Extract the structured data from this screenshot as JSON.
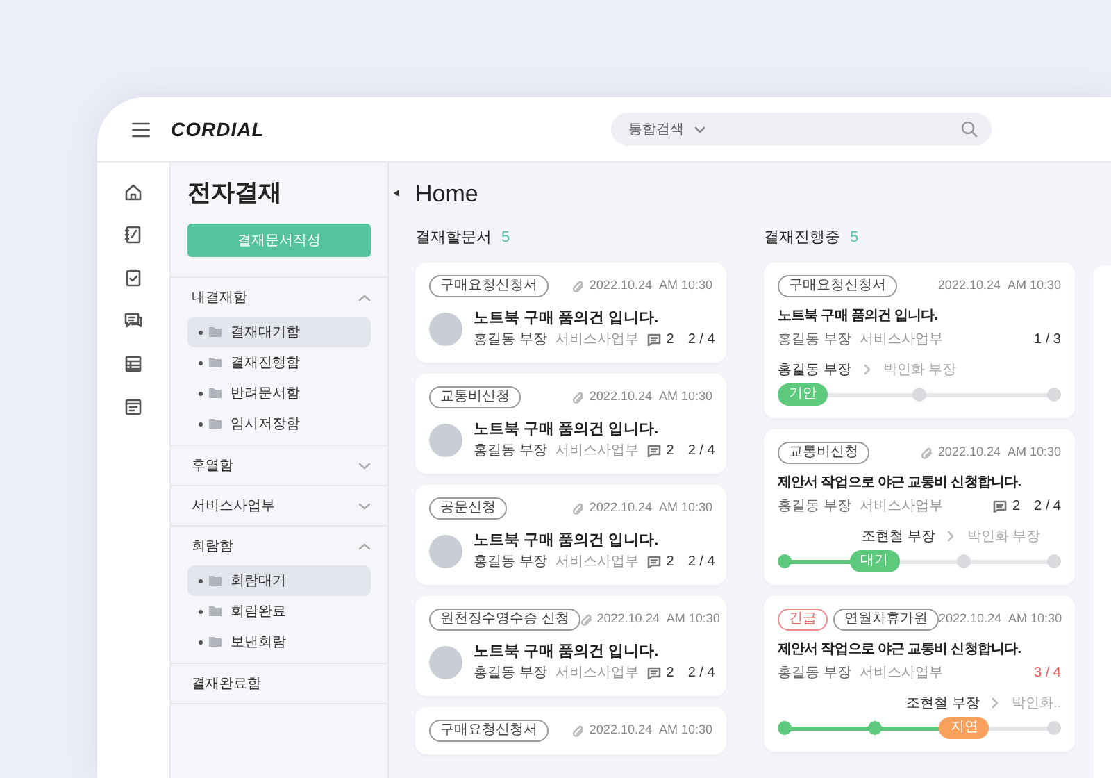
{
  "header": {
    "logo": "CORDIAL",
    "search": {
      "scope": "통합검색"
    }
  },
  "sidebar": {
    "title": "전자결재",
    "button": "결재문서작성",
    "sections": [
      {
        "label": "내결재함",
        "kind": "group",
        "expanded": true,
        "children": [
          {
            "label": "결재대기함",
            "selected": true
          },
          {
            "label": "결재진행함",
            "selected": false
          },
          {
            "label": "반려문서함",
            "selected": false
          },
          {
            "label": "임시저장함",
            "selected": false
          }
        ]
      },
      {
        "label": "후열함",
        "kind": "group",
        "expanded": false
      },
      {
        "label": "서비스사업부",
        "kind": "group",
        "expanded": false
      },
      {
        "label": "회람함",
        "kind": "group",
        "expanded": true,
        "children": [
          {
            "label": "회람대기",
            "selected": true
          },
          {
            "label": "회람완료",
            "selected": false
          },
          {
            "label": "보낸회람",
            "selected": false
          }
        ]
      },
      {
        "label": "결재완료함",
        "kind": "link"
      }
    ]
  },
  "main": {
    "title": "Home",
    "columns": [
      {
        "title": "결재할문서",
        "count": "5",
        "cards": [
          {
            "tags": [
              {
                "label": "구매요청신청서",
                "kind": "normal"
              }
            ],
            "attachment": true,
            "date": "2022.10.24",
            "time": "AM 10:30",
            "title": "노트북 구매 품의건 입니다.",
            "author": "홍길동 부장",
            "department": "서비스사업부",
            "comments": "2",
            "progress": "2 / 4",
            "progress_alert": false
          },
          {
            "tags": [
              {
                "label": "교통비신청",
                "kind": "normal"
              }
            ],
            "attachment": true,
            "date": "2022.10.24",
            "time": "AM 10:30",
            "title": "노트북 구매 품의건 입니다.",
            "author": "홍길동 부장",
            "department": "서비스사업부",
            "comments": "2",
            "progress": "2 / 4",
            "progress_alert": false
          },
          {
            "tags": [
              {
                "label": "공문신청",
                "kind": "normal"
              }
            ],
            "attachment": true,
            "date": "2022.10.24",
            "time": "AM 10:30",
            "title": "노트북 구매 품의건 입니다.",
            "author": "홍길동 부장",
            "department": "서비스사업부",
            "comments": "2",
            "progress": "2 / 4",
            "progress_alert": false
          },
          {
            "tags": [
              {
                "label": "원천징수영수증 신청",
                "kind": "normal"
              }
            ],
            "attachment": true,
            "date": "2022.10.24",
            "time": "AM 10:30",
            "title": "노트북 구매 품의건 입니다.",
            "author": "홍길동 부장",
            "department": "서비스사업부",
            "comments": "2",
            "progress": "2 / 4",
            "progress_alert": false
          },
          {
            "tags": [
              {
                "label": "구매요청신청서",
                "kind": "normal"
              }
            ],
            "attachment": true,
            "date": "2022.10.24",
            "time": "AM 10:30"
          }
        ]
      },
      {
        "title": "결재진행중",
        "count": "5",
        "cards": [
          {
            "tags": [
              {
                "label": "구매요청신청서",
                "kind": "normal"
              }
            ],
            "attachment": false,
            "date": "2022.10.24",
            "time": "AM 10:30",
            "title": "노트북 구매 품의건 입니다.",
            "author": "홍길동 부장",
            "department": "서비스사업부",
            "progress": "1 / 3",
            "progress_alert": false,
            "approvers": [
              {
                "name": "홍길동 부장",
                "current": true
              },
              {
                "name": "박인화 부장",
                "current": false
              }
            ],
            "steps": [
              {
                "kind": "current",
                "label": "기안",
                "color": "#5cc97c"
              },
              {
                "kind": "pending"
              },
              {
                "kind": "pending"
              }
            ]
          },
          {
            "tags": [
              {
                "label": "교통비신청",
                "kind": "normal"
              }
            ],
            "attachment": true,
            "date": "2022.10.24",
            "time": "AM 10:30",
            "title": "제안서 작업으로 야근 교통비 신청합니다.",
            "author": "홍길동 부장",
            "department": "서비스사업부",
            "comments": "2",
            "progress": "2 / 4",
            "progress_alert": false,
            "approvers": [
              {
                "name": "조현철 부장",
                "current": true
              },
              {
                "name": "박인화 부장",
                "current": false
              }
            ],
            "steps": [
              {
                "kind": "done"
              },
              {
                "kind": "current",
                "label": "대기",
                "color": "#5cc97c"
              },
              {
                "kind": "pending"
              },
              {
                "kind": "pending"
              }
            ]
          },
          {
            "tags": [
              {
                "label": "긴급",
                "kind": "urgent"
              },
              {
                "label": "연월차휴가원",
                "kind": "normal"
              }
            ],
            "attachment": false,
            "date": "2022.10.24",
            "time": "AM 10:30",
            "title": "제안서 작업으로 야근 교통비 신청합니다.",
            "author": "홍길동 부장",
            "department": "서비스사업부",
            "progress": "3 / 4",
            "progress_alert": true,
            "approvers": [
              {
                "name": "조현철 부장",
                "current": true
              },
              {
                "name": "박인화..",
                "current": false
              }
            ],
            "steps": [
              {
                "kind": "done"
              },
              {
                "kind": "done"
              },
              {
                "kind": "current",
                "label": "지연",
                "color": "#f7a15c"
              },
              {
                "kind": "pending"
              }
            ]
          }
        ]
      }
    ]
  }
}
